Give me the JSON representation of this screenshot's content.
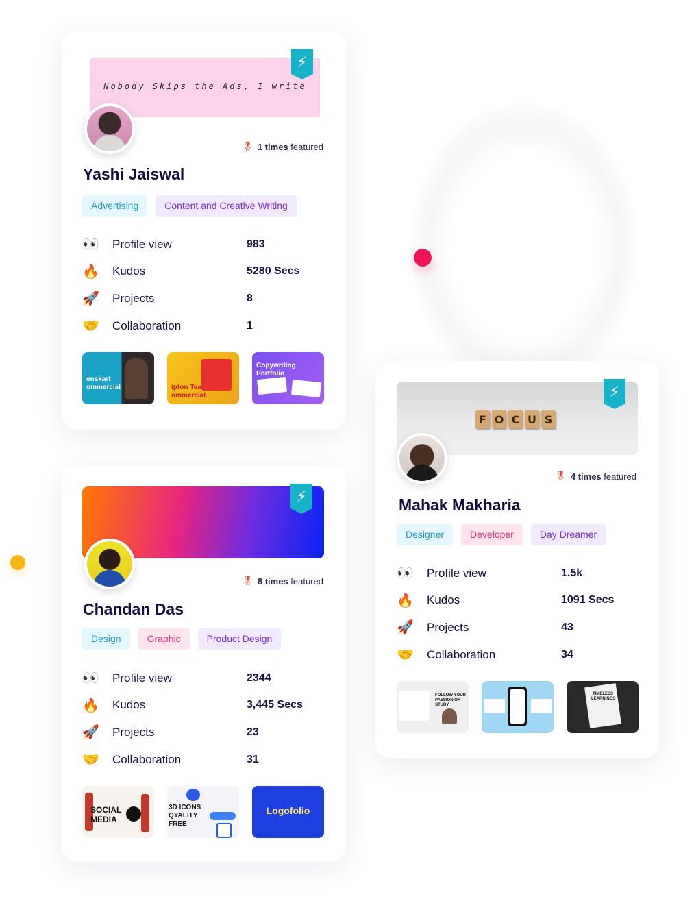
{
  "cards": [
    {
      "banner_quote": "Nobody Skips the Ads, I write",
      "featured_count": "1 times",
      "featured_suffix": "featured",
      "name": "Yashi Jaiswal",
      "tags": [
        "Advertising",
        "Content and Creative Writing"
      ],
      "stats": [
        {
          "icon": "eyes-icon",
          "emoji": "👀",
          "label": "Profile view",
          "value": "983"
        },
        {
          "icon": "fire-icon",
          "emoji": "🔥",
          "label": "Kudos",
          "value": "5280 Secs"
        },
        {
          "icon": "rocket-icon",
          "emoji": "🚀",
          "label": "Projects",
          "value": "8"
        },
        {
          "icon": "handshake-icon",
          "emoji": "🤝",
          "label": "Collaboration",
          "value": "1"
        }
      ],
      "thumbnails": [
        {
          "text": "enskart ommercial"
        },
        {
          "text": "ipton Tea ommercial"
        },
        {
          "text": "Copywriting Portfolio"
        }
      ]
    },
    {
      "featured_count": "8 times",
      "featured_suffix": "featured",
      "name": "Chandan Das",
      "tags": [
        "Design",
        "Graphic",
        "Product Design"
      ],
      "stats": [
        {
          "icon": "eyes-icon",
          "emoji": "👀",
          "label": "Profile view",
          "value": "2344"
        },
        {
          "icon": "fire-icon",
          "emoji": "🔥",
          "label": "Kudos",
          "value": "3,445 Secs"
        },
        {
          "icon": "rocket-icon",
          "emoji": "🚀",
          "label": "Projects",
          "value": "23"
        },
        {
          "icon": "handshake-icon",
          "emoji": "🤝",
          "label": "Collaboration",
          "value": "31"
        }
      ],
      "thumbnails": [
        {
          "text": "SOCIAL MEDIA"
        },
        {
          "text": "3D ICONS QYALITY FREE"
        },
        {
          "text": "Logofolio"
        }
      ]
    },
    {
      "banner_tiles": [
        "F",
        "O",
        "C",
        "U",
        "S"
      ],
      "featured_count": "4 times",
      "featured_suffix": "featured",
      "name": "Mahak Makharia",
      "tags": [
        "Designer",
        "Developer",
        "Day Dreamer"
      ],
      "stats": [
        {
          "icon": "eyes-icon",
          "emoji": "👀",
          "label": "Profile view",
          "value": "1.5k"
        },
        {
          "icon": "fire-icon",
          "emoji": "🔥",
          "label": "Kudos",
          "value": "1091 Secs"
        },
        {
          "icon": "rocket-icon",
          "emoji": "🚀",
          "label": "Projects",
          "value": "43"
        },
        {
          "icon": "handshake-icon",
          "emoji": "🤝",
          "label": "Collaboration",
          "value": "34"
        }
      ],
      "thumbnails": [
        {
          "text": "FOLLOW YOUR PASSION OR STUDY"
        },
        {
          "text": ""
        },
        {
          "text": "TIMELESS LEARNINGS"
        }
      ]
    }
  ],
  "colors": {
    "accent_badge": "#17b3c8",
    "dot_pink": "#f0145a",
    "dot_yellow": "#fbb316",
    "name_text": "#120d3a"
  }
}
